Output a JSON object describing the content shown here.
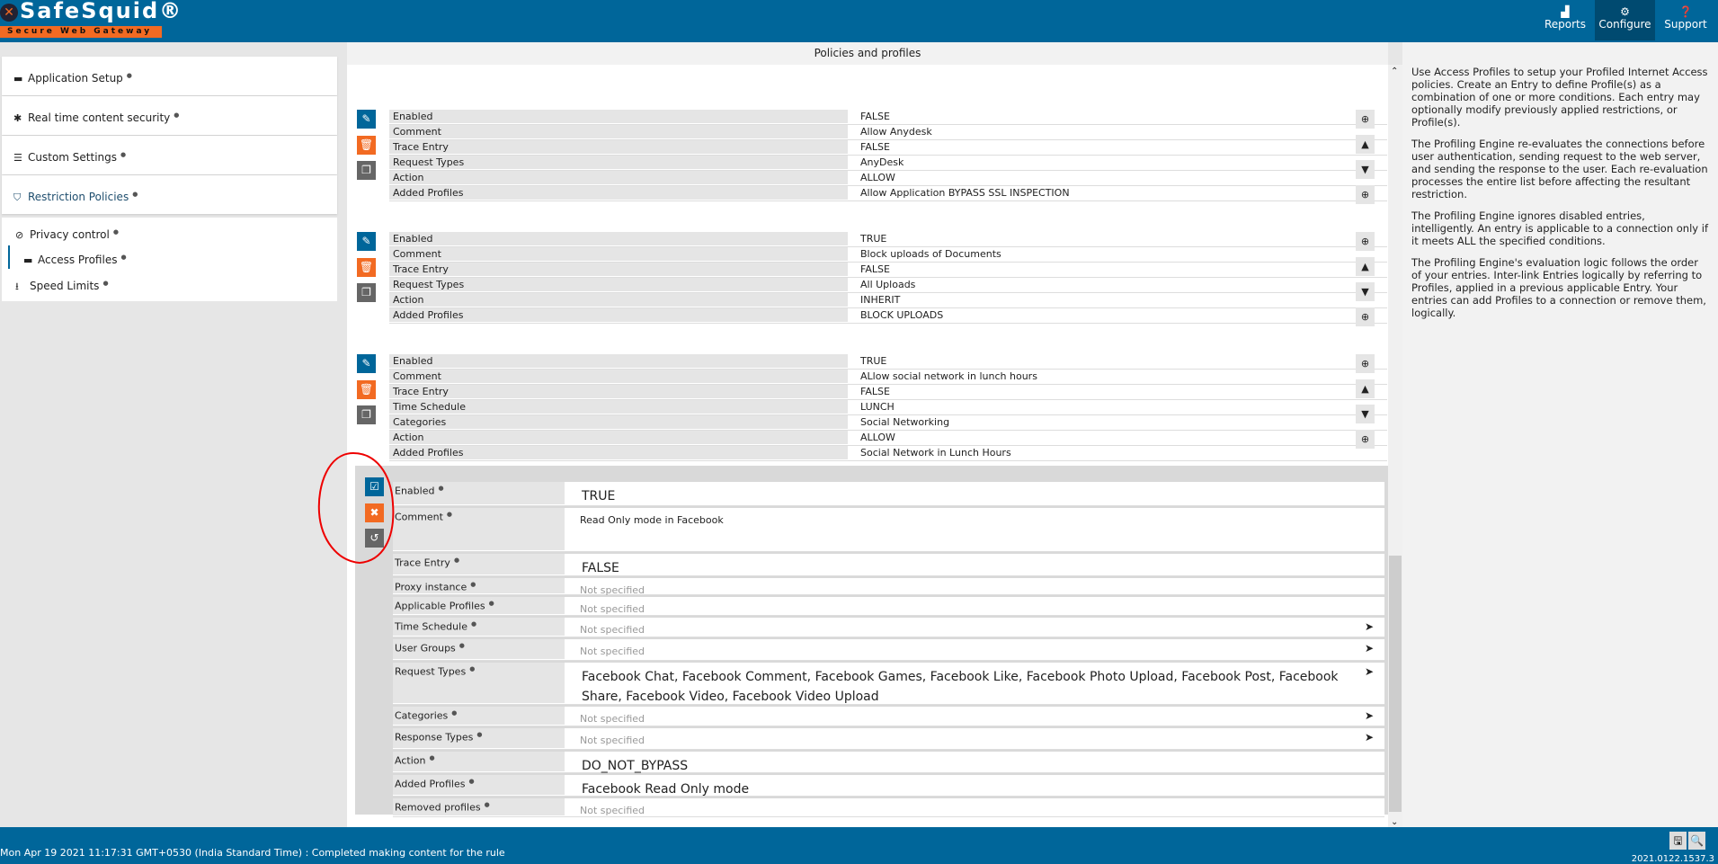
{
  "header": {
    "logo_text": "SafeSquid®",
    "logo_tagline": "Secure Web Gateway",
    "nav": [
      {
        "label": "Reports",
        "icon": "chart-area-icon"
      },
      {
        "label": "Configure",
        "icon": "cogs-icon",
        "active": true
      },
      {
        "label": "Support",
        "icon": "question-circle-icon"
      }
    ]
  },
  "colors": {
    "brand": "#00669a",
    "accent": "#f26a22",
    "active_nav": "#004a70"
  },
  "sidebar": {
    "sections": [
      {
        "label": "Application Setup",
        "icon": "briefcase-icon"
      },
      {
        "label": "Real time content security",
        "icon": "bug-icon"
      },
      {
        "label": "Custom Settings",
        "icon": "sliders-icon"
      },
      {
        "label": "Restriction Policies",
        "icon": "shield-icon"
      }
    ],
    "items": [
      {
        "label": "Privacy control",
        "icon": "ban-icon"
      },
      {
        "label": "Access Profiles",
        "icon": "briefcase-icon",
        "active": true
      },
      {
        "label": "Speed Limits",
        "icon": "download-icon"
      }
    ]
  },
  "main": {
    "title": "Policies and profiles",
    "entries": [
      {
        "rows": [
          [
            "Enabled",
            "FALSE"
          ],
          [
            "Comment",
            "Allow Anydesk"
          ],
          [
            "Trace Entry",
            "FALSE"
          ],
          [
            "Request Types",
            "AnyDesk"
          ],
          [
            "Action",
            "ALLOW"
          ],
          [
            "Added Profiles",
            "Allow Application  BYPASS SSL INSPECTION"
          ]
        ]
      },
      {
        "rows": [
          [
            "Enabled",
            "TRUE"
          ],
          [
            "Comment",
            "Block uploads of Documents"
          ],
          [
            "Trace Entry",
            "FALSE"
          ],
          [
            "Request Types",
            "All Uploads"
          ],
          [
            "Action",
            "INHERIT"
          ],
          [
            "Added Profiles",
            "BLOCK UPLOADS"
          ]
        ]
      },
      {
        "rows": [
          [
            "Enabled",
            "TRUE"
          ],
          [
            "Comment",
            "ALlow social network in lunch hours"
          ],
          [
            "Trace Entry",
            "FALSE"
          ],
          [
            "Time Schedule",
            "LUNCH"
          ],
          [
            "Categories",
            "Social Networking"
          ],
          [
            "Action",
            "ALLOW"
          ],
          [
            "Added Profiles",
            "Social Network in Lunch Hours"
          ]
        ]
      }
    ],
    "edit_form": {
      "rows": [
        {
          "label": "Enabled",
          "value": "TRUE"
        },
        {
          "label": "Comment",
          "value": "Read Only mode in Facebook",
          "type": "comment"
        },
        {
          "label": "Trace Entry",
          "value": "FALSE"
        },
        {
          "label": "Proxy instance",
          "value": "Not specified",
          "ns": true
        },
        {
          "label": "Applicable Profiles",
          "value": "Not specified",
          "ns": true
        },
        {
          "label": "Time Schedule",
          "value": "Not specified",
          "ns": true,
          "picker": true
        },
        {
          "label": "User Groups",
          "value": "Not specified",
          "ns": true,
          "picker": true
        },
        {
          "label": "Request Types",
          "value": "Facebook Chat,   Facebook Comment,   Facebook Games,   Facebook Like,   Facebook Photo Upload,   Facebook Post,   Facebook Share,   Facebook Video,   Facebook Video Upload",
          "picker": true
        },
        {
          "label": "Categories",
          "value": "Not specified",
          "ns": true,
          "picker": true
        },
        {
          "label": "Response Types",
          "value": "Not specified",
          "ns": true,
          "picker": true
        },
        {
          "label": "Action",
          "value": "DO_NOT_BYPASS"
        },
        {
          "label": "Added Profiles",
          "value": "Facebook Read Only mode"
        },
        {
          "label": "Removed profiles",
          "value": "Not specified",
          "ns": true
        }
      ]
    }
  },
  "help": {
    "paragraphs": [
      "Use Access Profiles to setup your Profiled Internet Access policies. Create an Entry to define Profile(s) as a combination of one or more conditions. Each entry may optionally modify previously applied restrictions, or Profile(s).",
      "The Profiling Engine re-evaluates the connections before user authentication, sending request to the web server, and sending the response to the user. Each re-evaluation processes the entire list before affecting the resultant restriction.",
      "The Profiling Engine ignores disabled entries, intelligently. An entry is applicable to a connection only if it meets ALL the specified conditions.",
      "The Profiling Engine's evaluation logic follows the order of your entries. Inter-link Entries logically by referring to Profiles, applied in a previous applicable Entry. Your entries can add Profiles to a connection or remove them, logically."
    ]
  },
  "footer": {
    "status": "Mon Apr 19 2021 11:17:31 GMT+0530 (India Standard Time) : Completed making content for the rule",
    "version": "2021.0122.1537.3"
  }
}
